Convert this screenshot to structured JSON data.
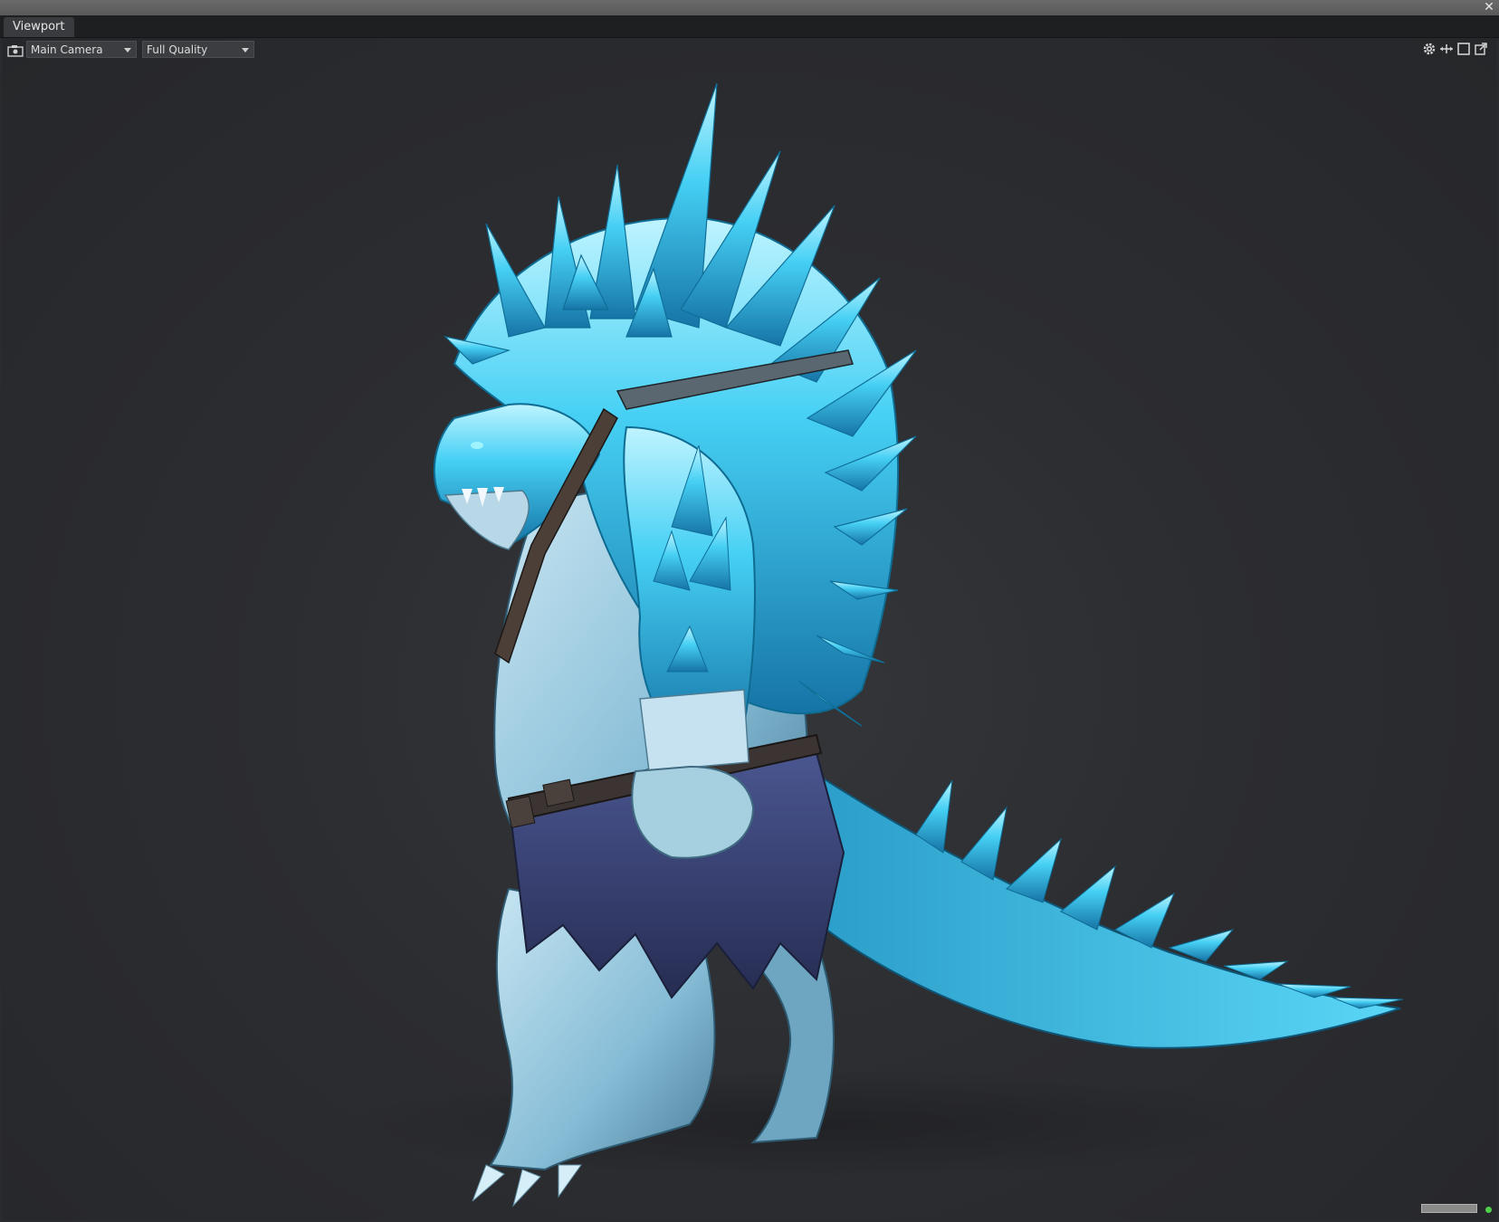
{
  "window": {
    "close_label": "✕"
  },
  "tabs": [
    {
      "label": "Viewport"
    }
  ],
  "toolbar": {
    "camera_select": {
      "value": "Main Camera"
    },
    "quality_select": {
      "value": "Full Quality"
    },
    "icons": [
      "camera-icon",
      "gear-icon",
      "move-icon",
      "maximize-icon",
      "popout-icon"
    ]
  },
  "scene": {
    "subject": "ice-crystal-creature-model"
  },
  "colors": {
    "background": "#2b2c30",
    "crystal": "#3cc6f0",
    "skin": "#8fc4dc",
    "cloth": "#3b4678",
    "status_indicator": "#4fd04a"
  }
}
